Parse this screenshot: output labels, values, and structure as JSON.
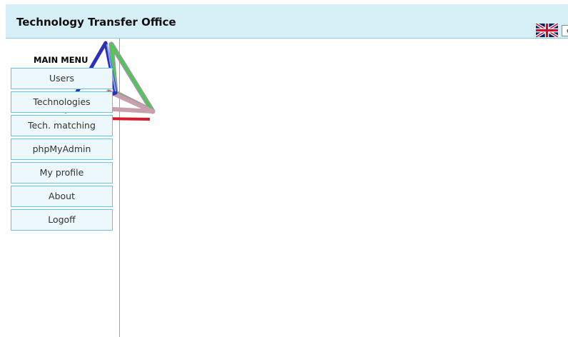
{
  "header": {
    "title": "Technology Transfer Office",
    "language": "en",
    "flag_icon": "uk-flag-icon"
  },
  "sidebar": {
    "menu_title": "MAIN MENU",
    "logo_icon": "triangles-logo-icon",
    "items": [
      {
        "label": "Users"
      },
      {
        "label": "Technologies"
      },
      {
        "label": "Tech. matching"
      },
      {
        "label": "phpMyAdmin"
      },
      {
        "label": "My profile"
      },
      {
        "label": "About"
      },
      {
        "label": "Logoff"
      }
    ]
  },
  "colors": {
    "header_bg": "#d6eef6",
    "menu_item_bg": "#edf8fc",
    "menu_item_border": "#5bc7e3",
    "divider": "#5fb6e0"
  }
}
